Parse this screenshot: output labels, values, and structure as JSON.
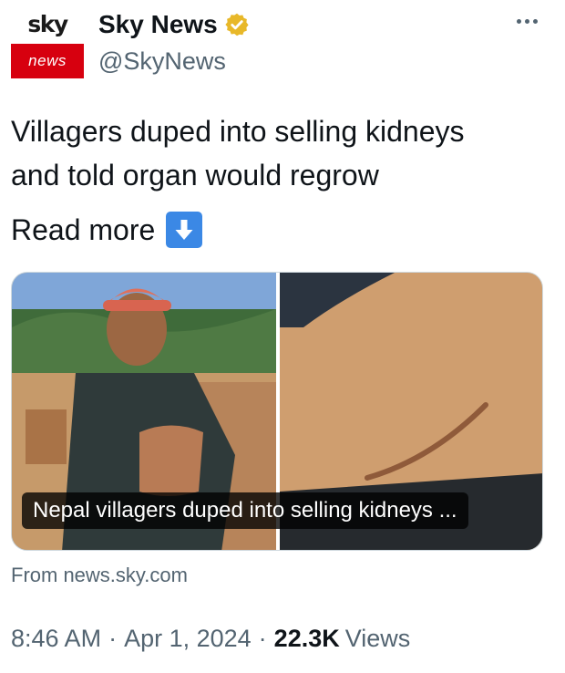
{
  "header": {
    "logo_top_text": "sky",
    "logo_bottom_text": "news",
    "display_name": "Sky News",
    "handle": "@SkyNews",
    "verified_icon": "verified-gold-badge-icon",
    "more_icon": "more-options-icon"
  },
  "tweet": {
    "text_lines": [
      "Villagers duped into selling kidneys",
      "and told organ would regrow"
    ],
    "read_more_label": "Read more",
    "read_more_icon": "down-arrow-emoji-icon"
  },
  "card": {
    "caption": "Nepal villagers duped into selling kidneys ...",
    "source": "From news.sky.com"
  },
  "meta": {
    "time": "8:46 AM",
    "separator": "·",
    "date": "Apr 1, 2024",
    "views_count": "22.3K",
    "views_label": "Views"
  },
  "colors": {
    "brand_red": "#d7000f",
    "verified_gold": "#e8b829",
    "secondary_text": "#536471",
    "primary_text": "#0f1419",
    "emoji_blue": "#3b88e5"
  }
}
